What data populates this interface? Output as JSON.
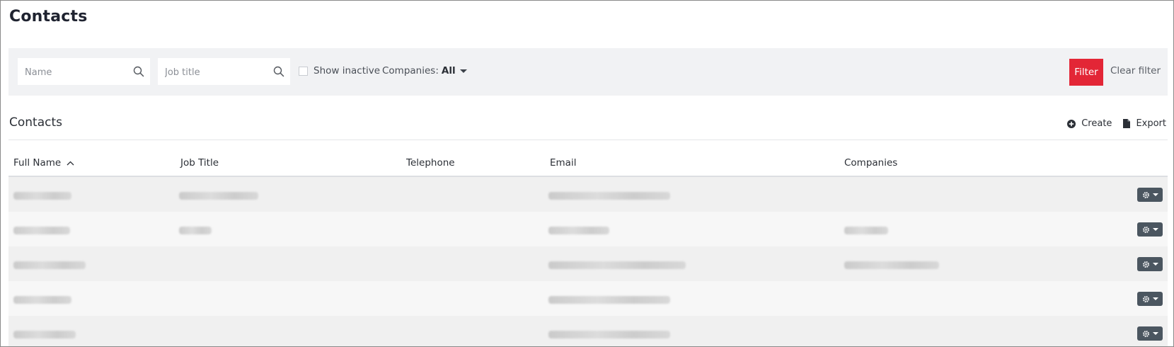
{
  "page": {
    "title": "Contacts"
  },
  "filters": {
    "name_placeholder": "Name",
    "name_value": "",
    "job_title_placeholder": "Job title",
    "job_title_value": "",
    "show_inactive_label": "Show inactive",
    "show_inactive_checked": false,
    "companies_label": "Companies:",
    "companies_value": "All",
    "filter_button": "Filter",
    "clear_filter": "Clear filter",
    "accent_color": "#e32636"
  },
  "section": {
    "title": "Contacts",
    "create_label": "Create",
    "export_label": "Export"
  },
  "table": {
    "columns": [
      "Full Name",
      "Job Title",
      "Telephone",
      "Email",
      "Companies"
    ],
    "sort": {
      "column": "Full Name",
      "direction": "ascending"
    },
    "rows": [
      {
        "full_name": "[redacted]",
        "job_title": "[redacted]",
        "telephone": "",
        "email": "[redacted]",
        "companies": ""
      },
      {
        "full_name": "[redacted]",
        "job_title": "[redacted]",
        "telephone": "",
        "email": "[redacted]",
        "companies": "[redacted]"
      },
      {
        "full_name": "[redacted]",
        "job_title": "",
        "telephone": "",
        "email": "[redacted]",
        "companies": "[redacted]"
      },
      {
        "full_name": "[redacted]",
        "job_title": "",
        "telephone": "",
        "email": "[redacted]",
        "companies": ""
      },
      {
        "full_name": "[redacted]",
        "job_title": "",
        "telephone": "",
        "email": "[redacted]",
        "companies": ""
      }
    ],
    "row_action_icon": "gear-icon"
  }
}
